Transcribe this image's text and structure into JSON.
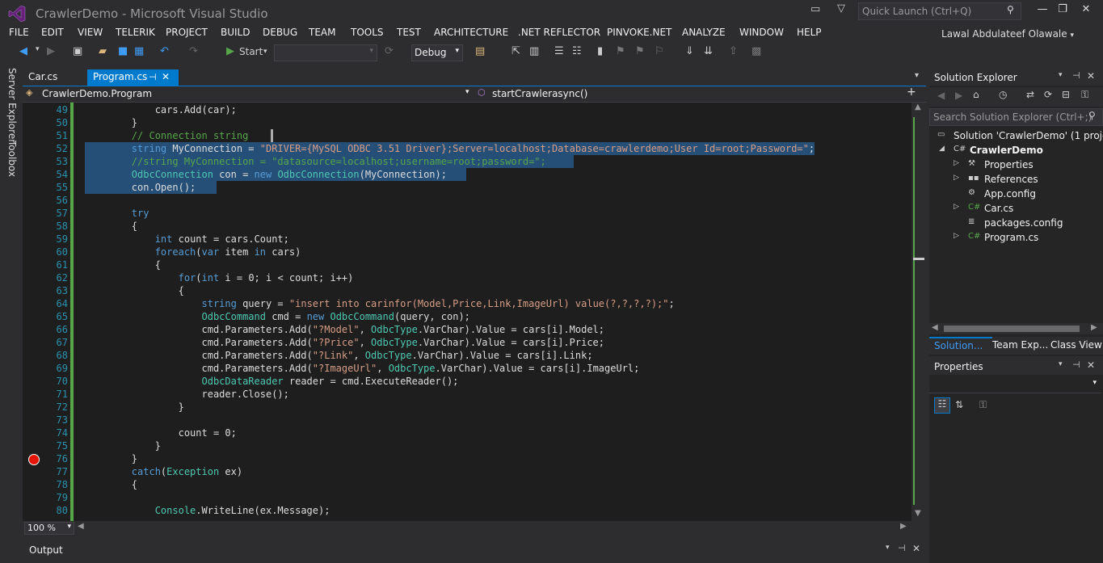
{
  "window": {
    "title": "CrawlerDemo - Microsoft Visual Studio",
    "quick_launch_placeholder": "Quick Launch (Ctrl+Q)",
    "user": "Lawal Abdulateef Olawale"
  },
  "menu": [
    "FILE",
    "EDIT",
    "VIEW",
    "TELERIK",
    "PROJECT",
    "BUILD",
    "DEBUG",
    "TEAM",
    "TOOLS",
    "TEST",
    "ARCHITECTURE",
    ".NET REFLECTOR",
    "PINVOKE.NET",
    "ANALYZE",
    "WINDOW",
    "HELP"
  ],
  "toolbar": {
    "start_label": "Start",
    "config_value": "Debug"
  },
  "left_strip": {
    "server_explorer": "Server Explorer",
    "toolbox": "Toolbox"
  },
  "tabs": [
    {
      "label": "Car.cs",
      "active": false
    },
    {
      "label": "Program.cs",
      "active": true
    }
  ],
  "navbar": {
    "left": "CrawlerDemo.Program",
    "right": "startCrawlerasync()"
  },
  "editor": {
    "zoom": "100 %",
    "breakpoint_line": 76,
    "lines": [
      {
        "n": 49,
        "tokens": [
          [
            "p",
            "            cars.Add(car);"
          ]
        ]
      },
      {
        "n": 50,
        "tokens": [
          [
            "p",
            "        }"
          ]
        ]
      },
      {
        "n": 51,
        "tokens": [
          [
            "c",
            "        // Connection string "
          ]
        ]
      },
      {
        "n": 52,
        "tokens": [
          [
            "p",
            "        "
          ],
          [
            "k",
            "string"
          ],
          [
            "p",
            " MyConnection = "
          ],
          [
            "s",
            "\"DRIVER={MySQL ODBC 3.51 Driver};Server=localhost;Database=crawlerdemo;User Id=root;Password=\""
          ],
          [
            "p",
            ";"
          ]
        ]
      },
      {
        "n": 53,
        "tokens": [
          [
            "c",
            "        //string MyConnection = \"datasource=localhost;username=root;password=\";"
          ]
        ]
      },
      {
        "n": 54,
        "tokens": [
          [
            "p",
            "        "
          ],
          [
            "t",
            "OdbcConnection"
          ],
          [
            "p",
            " con = "
          ],
          [
            "k",
            "new"
          ],
          [
            "p",
            " "
          ],
          [
            "t",
            "OdbcConnection"
          ],
          [
            "p",
            "(MyConnection);"
          ]
        ]
      },
      {
        "n": 55,
        "tokens": [
          [
            "p",
            "        con.Open();"
          ]
        ]
      },
      {
        "n": 56,
        "tokens": [
          [
            "p",
            ""
          ]
        ]
      },
      {
        "n": 57,
        "tokens": [
          [
            "p",
            "        "
          ],
          [
            "k",
            "try"
          ]
        ]
      },
      {
        "n": 58,
        "tokens": [
          [
            "p",
            "        {"
          ]
        ]
      },
      {
        "n": 59,
        "tokens": [
          [
            "p",
            "            "
          ],
          [
            "k",
            "int"
          ],
          [
            "p",
            " count = cars.Count;"
          ]
        ]
      },
      {
        "n": 60,
        "tokens": [
          [
            "p",
            "            "
          ],
          [
            "k",
            "foreach"
          ],
          [
            "p",
            "("
          ],
          [
            "k",
            "var"
          ],
          [
            "p",
            " item "
          ],
          [
            "k",
            "in"
          ],
          [
            "p",
            " cars)"
          ]
        ]
      },
      {
        "n": 61,
        "tokens": [
          [
            "p",
            "            {"
          ]
        ]
      },
      {
        "n": 62,
        "tokens": [
          [
            "p",
            "                "
          ],
          [
            "k",
            "for"
          ],
          [
            "p",
            "("
          ],
          [
            "k",
            "int"
          ],
          [
            "p",
            " i = 0; i < count; i++)"
          ]
        ]
      },
      {
        "n": 63,
        "tokens": [
          [
            "p",
            "                {"
          ]
        ]
      },
      {
        "n": 64,
        "tokens": [
          [
            "p",
            "                    "
          ],
          [
            "k",
            "string"
          ],
          [
            "p",
            " query = "
          ],
          [
            "s",
            "\"insert into carinfor(Model,Price,Link,ImageUrl) value(?,?,?,?);\""
          ],
          [
            "p",
            ";"
          ]
        ]
      },
      {
        "n": 65,
        "tokens": [
          [
            "p",
            "                    "
          ],
          [
            "t",
            "OdbcCommand"
          ],
          [
            "p",
            " cmd = "
          ],
          [
            "k",
            "new"
          ],
          [
            "p",
            " "
          ],
          [
            "t",
            "OdbcCommand"
          ],
          [
            "p",
            "(query, con);"
          ]
        ]
      },
      {
        "n": 66,
        "tokens": [
          [
            "p",
            "                    cmd.Parameters.Add("
          ],
          [
            "s",
            "\"?Model\""
          ],
          [
            "p",
            ", "
          ],
          [
            "t",
            "OdbcType"
          ],
          [
            "p",
            ".VarChar).Value = cars[i].Model;"
          ]
        ]
      },
      {
        "n": 67,
        "tokens": [
          [
            "p",
            "                    cmd.Parameters.Add("
          ],
          [
            "s",
            "\"?Price\""
          ],
          [
            "p",
            ", "
          ],
          [
            "t",
            "OdbcType"
          ],
          [
            "p",
            ".VarChar).Value = cars[i].Price;"
          ]
        ]
      },
      {
        "n": 68,
        "tokens": [
          [
            "p",
            "                    cmd.Parameters.Add("
          ],
          [
            "s",
            "\"?Link\""
          ],
          [
            "p",
            ", "
          ],
          [
            "t",
            "OdbcType"
          ],
          [
            "p",
            ".VarChar).Value = cars[i].Link;"
          ]
        ]
      },
      {
        "n": 69,
        "tokens": [
          [
            "p",
            "                    cmd.Parameters.Add("
          ],
          [
            "s",
            "\"?ImageUrl\""
          ],
          [
            "p",
            ", "
          ],
          [
            "t",
            "OdbcType"
          ],
          [
            "p",
            ".VarChar).Value = cars[i].ImageUrl;"
          ]
        ]
      },
      {
        "n": 70,
        "tokens": [
          [
            "p",
            "                    "
          ],
          [
            "t",
            "OdbcDataReader"
          ],
          [
            "p",
            " reader = cmd.ExecuteReader();"
          ]
        ]
      },
      {
        "n": 71,
        "tokens": [
          [
            "p",
            "                    reader.Close();"
          ]
        ]
      },
      {
        "n": 72,
        "tokens": [
          [
            "p",
            "                }"
          ]
        ]
      },
      {
        "n": 73,
        "tokens": [
          [
            "p",
            ""
          ]
        ]
      },
      {
        "n": 74,
        "tokens": [
          [
            "p",
            "                count = 0;"
          ]
        ]
      },
      {
        "n": 75,
        "tokens": [
          [
            "p",
            "            }"
          ]
        ]
      },
      {
        "n": 76,
        "tokens": [
          [
            "p",
            "        }"
          ]
        ]
      },
      {
        "n": 77,
        "tokens": [
          [
            "p",
            "        "
          ],
          [
            "k",
            "catch"
          ],
          [
            "p",
            "("
          ],
          [
            "t",
            "Exception"
          ],
          [
            "p",
            " ex)"
          ]
        ]
      },
      {
        "n": 78,
        "tokens": [
          [
            "p",
            "        {"
          ]
        ]
      },
      {
        "n": 79,
        "tokens": [
          [
            "p",
            ""
          ]
        ]
      },
      {
        "n": 80,
        "tokens": [
          [
            "p",
            "            "
          ],
          [
            "t",
            "Console"
          ],
          [
            "p",
            ".WriteLine(ex.Message);"
          ]
        ]
      }
    ]
  },
  "solution_explorer": {
    "title": "Solution Explorer",
    "search_placeholder": "Search Solution Explorer (Ctrl+;)",
    "items": [
      {
        "label": "Solution 'CrawlerDemo' (1 project)",
        "depth": 0
      },
      {
        "label": "CrawlerDemo",
        "depth": 1
      },
      {
        "label": "Properties",
        "depth": 2
      },
      {
        "label": "References",
        "depth": 2
      },
      {
        "label": "App.config",
        "depth": 2
      },
      {
        "label": "Car.cs",
        "depth": 2
      },
      {
        "label": "packages.config",
        "depth": 2
      },
      {
        "label": "Program.cs",
        "depth": 2
      }
    ],
    "bottom_tabs": [
      "Solution...",
      "Team Exp...",
      "Class View"
    ]
  },
  "properties": {
    "title": "Properties"
  },
  "output": {
    "title": "Output"
  }
}
